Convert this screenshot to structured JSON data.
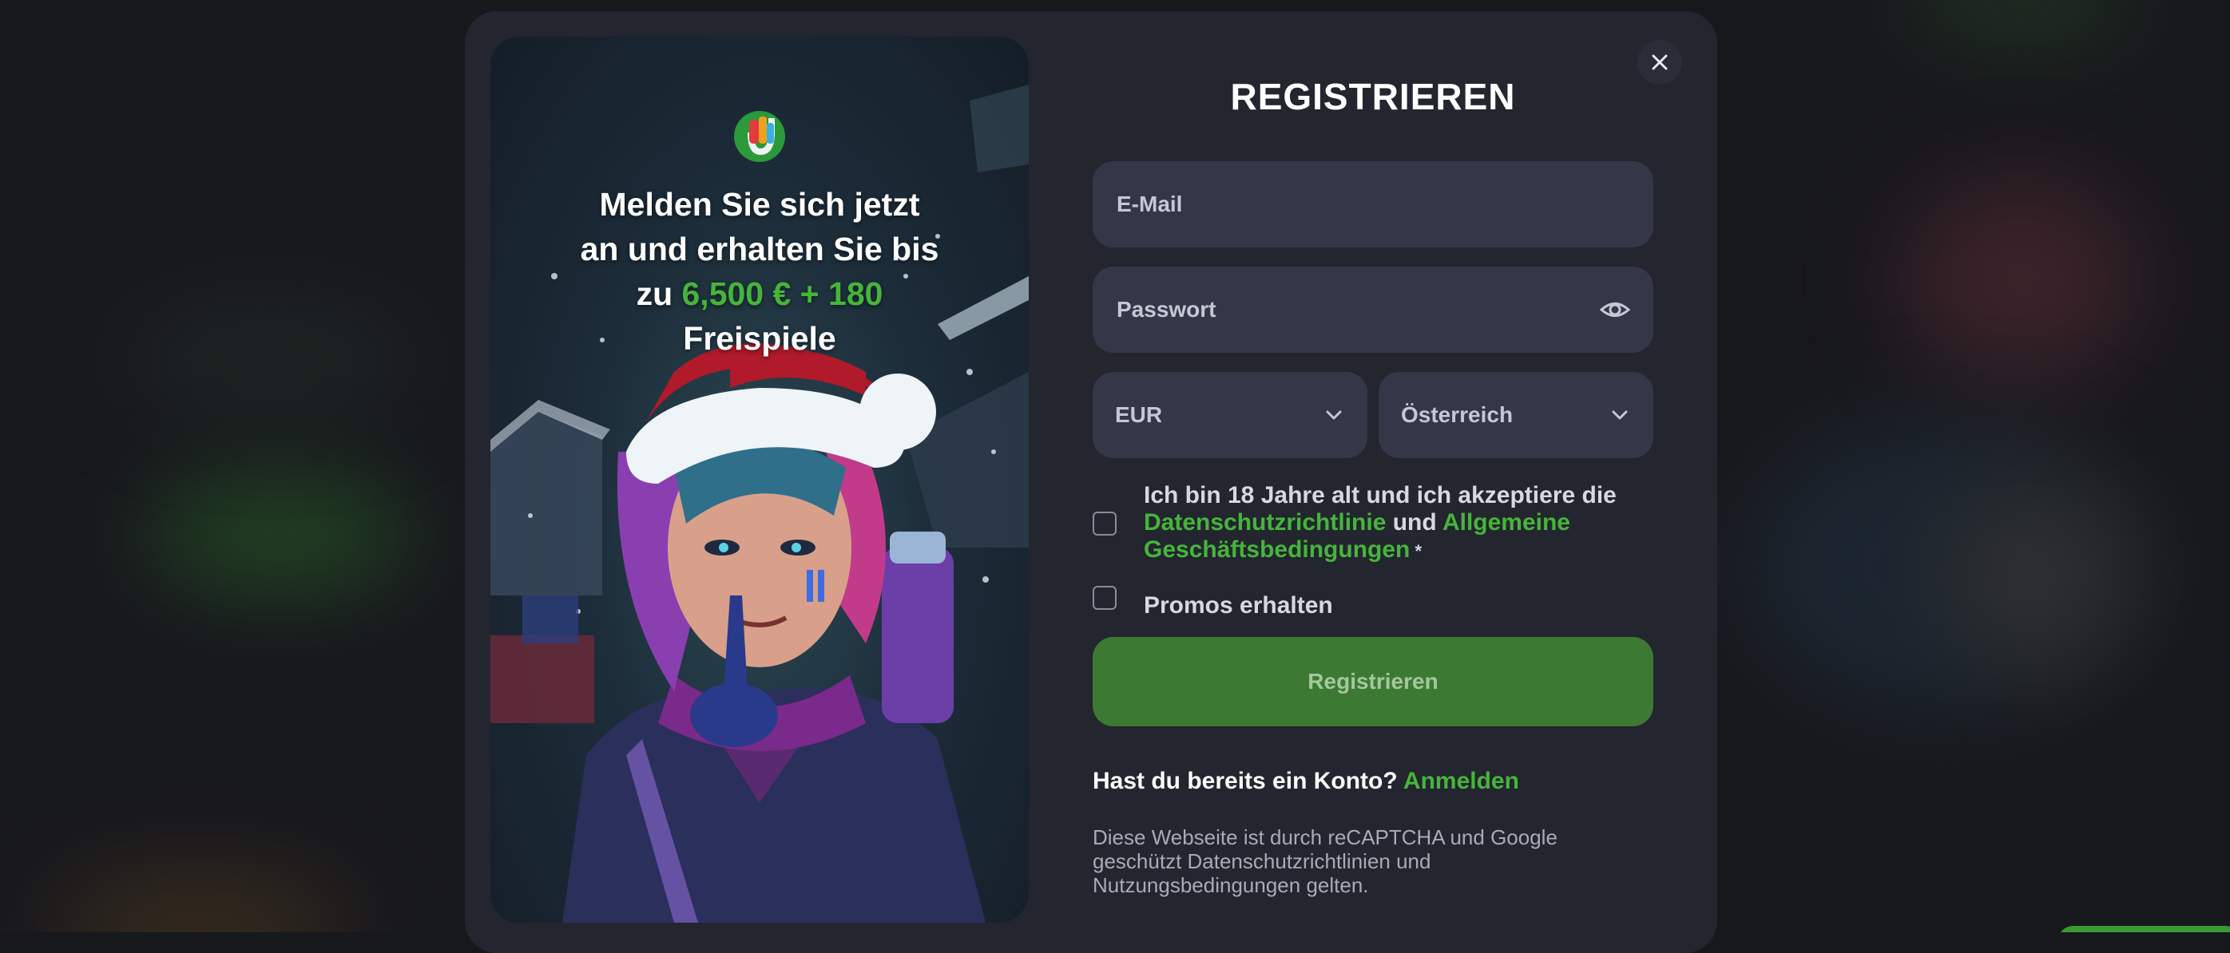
{
  "promo": {
    "line1": "Melden Sie sich jetzt",
    "line2": "an und erhalten Sie bis",
    "line3_prefix": "zu ",
    "bonus": "6,500 € + 180",
    "line4": "Freispiele"
  },
  "form": {
    "title": "REGISTRIEREN",
    "email_placeholder": "E-Mail",
    "password_placeholder": "Passwort",
    "currency": "EUR",
    "country": "Österreich",
    "consent": {
      "text_before": "Ich bin 18 Jahre alt und ich akzeptiere die ",
      "privacy_link": "Datenschutzrichtlinie",
      "conjunction": " und ",
      "terms_link": "Allgemeine Geschäftsbedingungen",
      "required_mark": " *"
    },
    "promos_label": "Promos erhalten",
    "submit_label": "Registrieren",
    "login_question": "Hast du bereits ein Konto? ",
    "login_link": "Anmelden",
    "recaptcha_notice": "Diese Webseite ist durch reCAPTCHA und Google geschützt Datenschutzrichtlinien und Nutzungsbedingungen gelten."
  },
  "colors": {
    "accent": "#45b53a",
    "button": "#3c7a33",
    "modal_bg": "#23252f",
    "field_bg": "#343748"
  },
  "icons": {
    "close": "close-icon",
    "password_toggle": "eye-icon",
    "dropdown": "chevron-down-icon"
  }
}
